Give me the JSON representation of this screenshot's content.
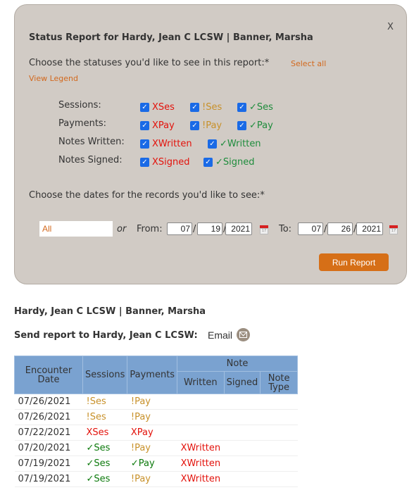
{
  "dialog": {
    "close_label": "X",
    "title": "Status Report for Hardy, Jean C LCSW | Banner, Marsha",
    "statuses_prompt": "Choose the statuses you'd like to see in this report:*",
    "select_all": "Select all",
    "view_legend": "View Legend",
    "groups": [
      {
        "label": "Sessions:",
        "options": [
          {
            "label": "XSes",
            "checked": true,
            "tone": "red"
          },
          {
            "label": "!Ses",
            "checked": true,
            "tone": "amber"
          },
          {
            "label": "✓Ses",
            "checked": true,
            "tone": "green"
          }
        ]
      },
      {
        "label": "Payments:",
        "options": [
          {
            "label": "XPay",
            "checked": true,
            "tone": "red"
          },
          {
            "label": "!Pay",
            "checked": true,
            "tone": "amber"
          },
          {
            "label": "✓Pay",
            "checked": true,
            "tone": "green"
          }
        ]
      },
      {
        "label": "Notes Written:",
        "options": [
          {
            "label": "XWritten",
            "checked": true,
            "tone": "red"
          },
          {
            "label": "✓Written",
            "checked": true,
            "tone": "green"
          }
        ]
      },
      {
        "label": "Notes Signed:",
        "options": [
          {
            "label": "XSigned",
            "checked": true,
            "tone": "red"
          },
          {
            "label": "✓Signed",
            "checked": true,
            "tone": "green"
          }
        ]
      }
    ],
    "dates_prompt": "Choose the dates for the records you'd like to see:*",
    "range_value": "All",
    "or_label": "or",
    "from_label": "From:",
    "from": {
      "month": "07",
      "day": "19",
      "year": "2021"
    },
    "to_label": "To:",
    "to": {
      "month": "07",
      "day": "26",
      "year": "2021"
    },
    "slash": "/",
    "calendar_glyph": "17",
    "run_button": "Run Report"
  },
  "report": {
    "title": "Hardy, Jean C LCSW | Banner, Marsha",
    "send_label": "Send report to Hardy, Jean C LCSW:",
    "email_label": "Email",
    "headers": {
      "encounter_date": "Encounter Date",
      "sessions": "Sessions",
      "payments": "Payments",
      "note": "Note",
      "written": "Written",
      "signed": "Signed",
      "note_type": "Note Type"
    },
    "rows": [
      {
        "date": "07/26/2021",
        "sessions": "!Ses",
        "payments": "!Pay",
        "written": "",
        "signed": "",
        "note_type": ""
      },
      {
        "date": "07/26/2021",
        "sessions": "!Ses",
        "payments": "!Pay",
        "written": "",
        "signed": "",
        "note_type": ""
      },
      {
        "date": "07/22/2021",
        "sessions": "XSes",
        "payments": "XPay",
        "written": "",
        "signed": "",
        "note_type": ""
      },
      {
        "date": "07/20/2021",
        "sessions": "✓Ses",
        "payments": "!Pay",
        "written": "XWritten",
        "signed": "",
        "note_type": ""
      },
      {
        "date": "07/19/2021",
        "sessions": "✓Ses",
        "payments": "✓Pay",
        "written": "XWritten",
        "signed": "",
        "note_type": ""
      },
      {
        "date": "07/19/2021",
        "sessions": "✓Ses",
        "payments": "!Pay",
        "written": "XWritten",
        "signed": "",
        "note_type": ""
      }
    ]
  },
  "colors": {
    "accent": "#d66f17",
    "link": "#d2691e",
    "panel_bg": "#d1cbc5",
    "header_bg": "#7aa2d0",
    "status_red": "#e3120b",
    "status_amber": "#c8912a",
    "status_green": "#1e8c3c"
  }
}
